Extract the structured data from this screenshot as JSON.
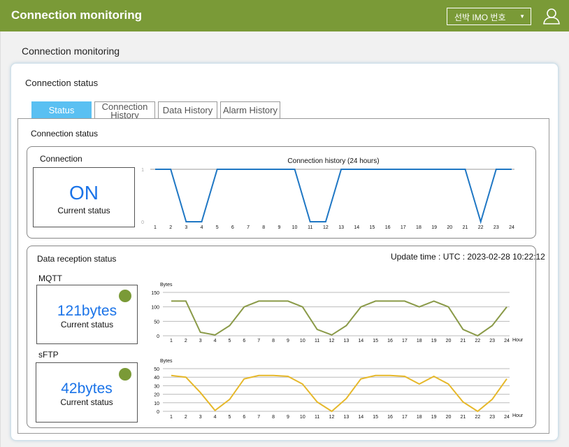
{
  "header": {
    "title": "Connection monitoring",
    "ship_select": "선박 IMO 번호"
  },
  "colors": {
    "header_bg": "#7a9a37",
    "tab_active": "#5ac0f2",
    "value_blue": "#1a73e8",
    "mqtt_line": "#8a9a48",
    "sftp_line": "#e6b82a",
    "connection_line": "#1f77c4",
    "status_dot": "#7a9a37"
  },
  "icons": {
    "user": "user-icon",
    "dropdown": "caret-down-icon"
  },
  "page": {
    "title": "Connection monitoring"
  },
  "card": {
    "title": "Connection status"
  },
  "tabs": [
    {
      "label": "Status",
      "active": true
    },
    {
      "label": "Connection History",
      "active": false
    },
    {
      "label": "Data History",
      "active": false
    },
    {
      "label": "Alarm History",
      "active": false
    }
  ],
  "panel": {
    "title": "Connection status"
  },
  "connection": {
    "label": "Connection",
    "status": "ON",
    "status_caption": "Current status"
  },
  "reception": {
    "label": "Data reception status",
    "update_time": "Update time : UTC : 2023-02-28 10:22:12",
    "mqtt": {
      "label": "MQTT",
      "value": "121bytes",
      "caption": "Current status"
    },
    "sftp": {
      "label": "sFTP",
      "value": "42bytes",
      "caption": "Current status"
    }
  },
  "chart_data": [
    {
      "type": "line",
      "title": "Connection history (24 hours)",
      "x": [
        1,
        2,
        3,
        4,
        5,
        6,
        7,
        8,
        9,
        10,
        11,
        12,
        13,
        14,
        15,
        16,
        17,
        18,
        19,
        20,
        21,
        22,
        23,
        24
      ],
      "ylim": [
        0,
        1
      ],
      "y_ticks": [
        0,
        1
      ],
      "series": [
        {
          "values": [
            1,
            1,
            0,
            0,
            1,
            1,
            1,
            1,
            1,
            1,
            0,
            0,
            1,
            1,
            1,
            1,
            1,
            1,
            1,
            1,
            1,
            0,
            1,
            1
          ]
        }
      ]
    },
    {
      "type": "line",
      "ylabel": "Bytes",
      "xlabel": "Hour",
      "x": [
        1,
        2,
        3,
        4,
        5,
        6,
        7,
        8,
        9,
        10,
        11,
        12,
        13,
        14,
        15,
        16,
        17,
        18,
        19,
        20,
        21,
        22,
        23,
        24
      ],
      "ylim": [
        0,
        150
      ],
      "y_ticks": [
        0,
        50,
        100,
        150
      ],
      "series": [
        {
          "values": [
            120,
            120,
            12,
            3,
            35,
            100,
            120,
            120,
            120,
            100,
            22,
            3,
            35,
            100,
            120,
            120,
            120,
            100,
            120,
            100,
            22,
            0,
            35,
            100
          ]
        }
      ]
    },
    {
      "type": "line",
      "ylabel": "Bytes",
      "xlabel": "Hour",
      "x": [
        1,
        2,
        3,
        4,
        5,
        6,
        7,
        8,
        9,
        10,
        11,
        12,
        13,
        14,
        15,
        16,
        17,
        18,
        19,
        20,
        21,
        22,
        23,
        24
      ],
      "ylim": [
        0,
        50
      ],
      "y_ticks": [
        0,
        10,
        20,
        30,
        40,
        50
      ],
      "series": [
        {
          "values": [
            42,
            40,
            22,
            1,
            14,
            38,
            42,
            42,
            41,
            32,
            11,
            0,
            15,
            38,
            42,
            42,
            41,
            32,
            41,
            32,
            11,
            0,
            14,
            38
          ]
        }
      ]
    }
  ]
}
